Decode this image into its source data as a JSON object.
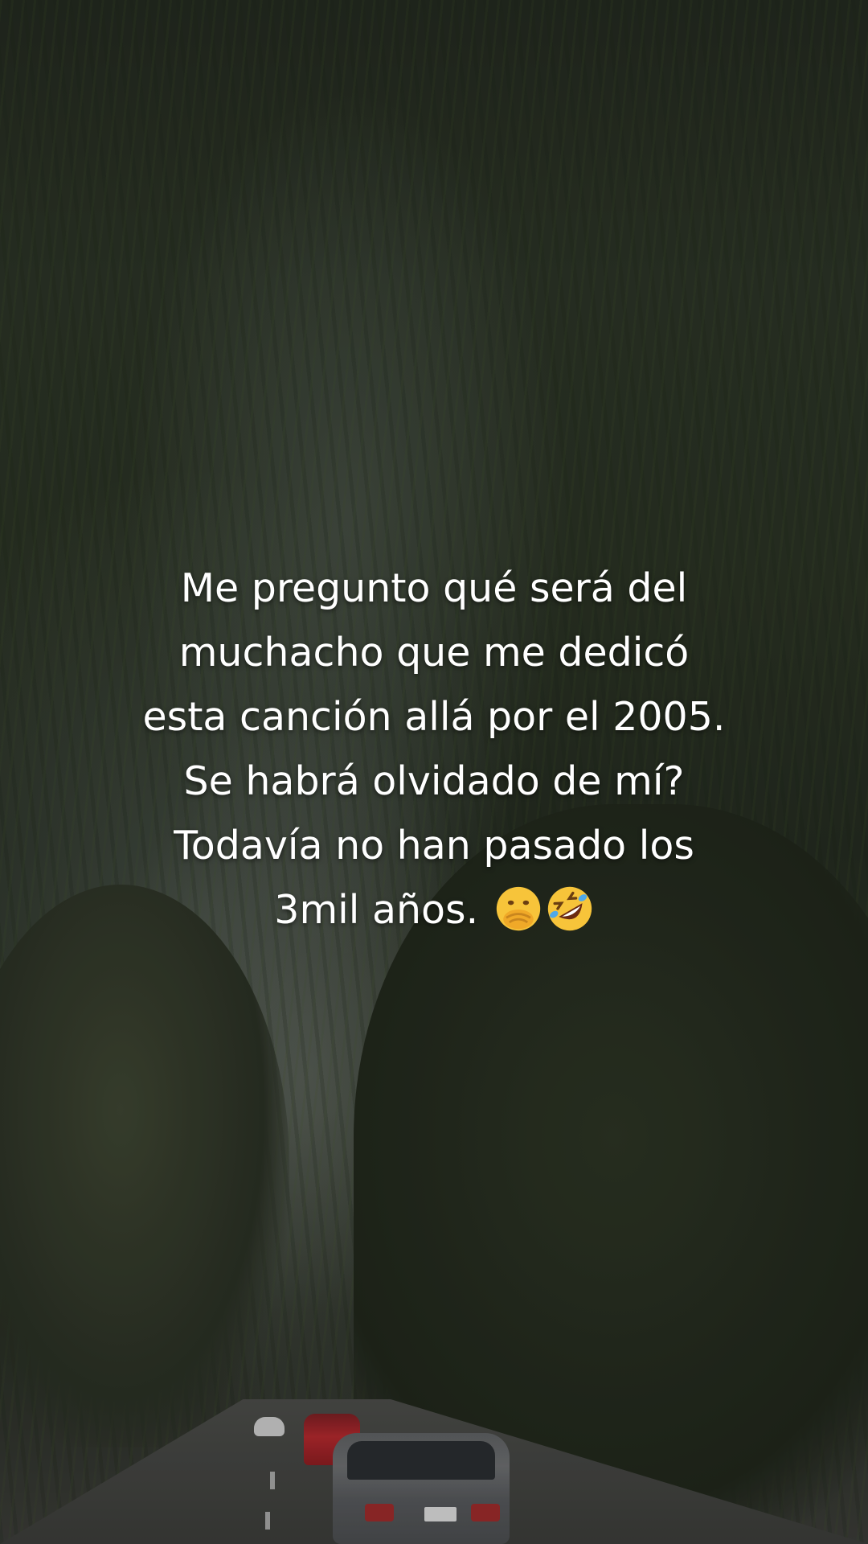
{
  "post": {
    "caption_lines": [
      "Me pregunto qué será del",
      "muchacho que me dedicó",
      "esta canción allá por el 2005.",
      "Se habrá olvidado de mí?",
      "Todavía no han pasado los",
      "3mil años."
    ],
    "emojis": [
      "face-with-hand-over-mouth-icon",
      "rolling-on-the-floor-laughing-icon"
    ]
  },
  "colors": {
    "caption_text": "#ffffff",
    "emoji_face": "#f7c43a",
    "emoji_hand": "#f0a928",
    "emoji_tears": "#4fa8e8"
  }
}
